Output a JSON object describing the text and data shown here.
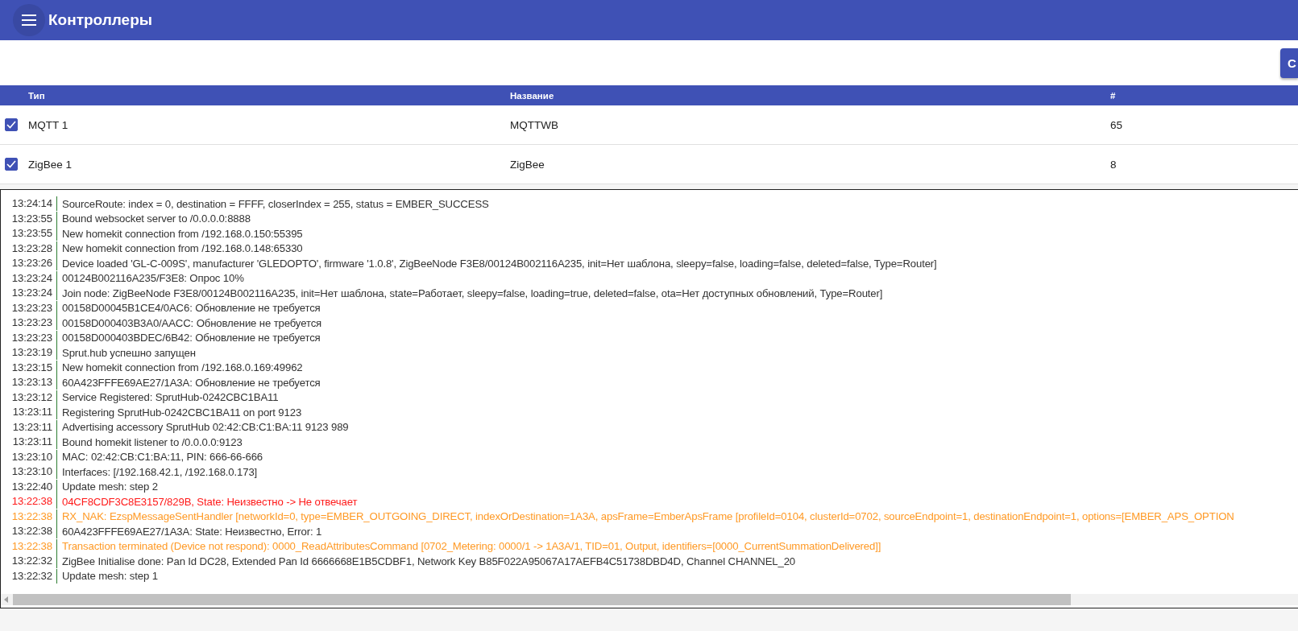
{
  "app_bar": {
    "title": "Контроллеры"
  },
  "toolbar": {
    "button": "С"
  },
  "table": {
    "columns": [
      "Тип",
      "Название",
      "#"
    ],
    "rows": [
      {
        "checked": true,
        "type": "MQTT 1",
        "name": "MQTTWB",
        "count": "65"
      },
      {
        "checked": true,
        "type": "ZigBee 1",
        "name": "ZigBee",
        "count": "8"
      }
    ]
  },
  "log": [
    {
      "time": "13:24:14",
      "kind": "info",
      "message": "SourceRoute: index = 0, destination = FFFF, closerIndex = 255, status = EMBER_SUCCESS"
    },
    {
      "time": "13:23:55",
      "kind": "info",
      "message": "Bound websocket server to /0.0.0.0:8888"
    },
    {
      "time": "13:23:55",
      "kind": "info",
      "message": "New homekit connection from /192.168.0.150:55395"
    },
    {
      "time": "13:23:28",
      "kind": "info",
      "message": "New homekit connection from /192.168.0.148:65330"
    },
    {
      "time": "13:23:26",
      "kind": "info",
      "message": "Device loaded 'GL-C-009S', manufacturer 'GLEDOPTO', firmware '1.0.8', ZigBeeNode F3E8/00124B002116A235, init=Нет шаблона, sleepy=false, loading=false, deleted=false, Type=Router]"
    },
    {
      "time": "13:23:24",
      "kind": "info",
      "message": "00124B002116A235/F3E8: Опрос 10%"
    },
    {
      "time": "13:23:24",
      "kind": "info",
      "message": "Join node: ZigBeeNode F3E8/00124B002116A235, init=Нет шаблона, state=Работает, sleepy=false, loading=true, deleted=false, ota=Нет доступных обновлений, Type=Router]"
    },
    {
      "time": "13:23:23",
      "kind": "info",
      "message": "00158D00045B1CE4/0AC6: Обновление не требуется"
    },
    {
      "time": "13:23:23",
      "kind": "info",
      "message": "00158D000403B3A0/AACC: Обновление не требуется"
    },
    {
      "time": "13:23:23",
      "kind": "info",
      "message": "00158D000403BDEC/6B42: Обновление не требуется"
    },
    {
      "time": "13:23:19",
      "kind": "info",
      "message": "Sprut.hub успешно запущен"
    },
    {
      "time": "13:23:15",
      "kind": "info",
      "message": "New homekit connection from /192.168.0.169:49962"
    },
    {
      "time": "13:23:13",
      "kind": "info",
      "message": "60A423FFFE69AE27/1A3A: Обновление не требуется"
    },
    {
      "time": "13:23:12",
      "kind": "info",
      "message": "Service Registered: SprutHub-0242CBC1BA11"
    },
    {
      "time": "13:23:11",
      "kind": "info",
      "message": "Registering SprutHub-0242CBC1BA11 on port 9123"
    },
    {
      "time": "13:23:11",
      "kind": "info",
      "message": "Advertising accessory SprutHub 02:42:CB:C1:BA:11 9123 989"
    },
    {
      "time": "13:23:11",
      "kind": "info",
      "message": "Bound homekit listener to /0.0.0.0:9123"
    },
    {
      "time": "13:23:10",
      "kind": "info",
      "message": "MAC: 02:42:CB:C1:BA:11, PIN: 666-66-666"
    },
    {
      "time": "13:23:10",
      "kind": "info",
      "message": "Interfaces: [/192.168.42.1, /192.168.0.173]"
    },
    {
      "time": "13:22:40",
      "kind": "info",
      "message": "Update mesh: step 2"
    },
    {
      "time": "13:22:38",
      "kind": "error",
      "message": "04CF8CDF3C8E3157/829B, State: Неизвестно -> Не отвечает"
    },
    {
      "time": "13:22:38",
      "kind": "warning",
      "message": "RX_NAK: EzspMessageSentHandler [networkId=0, type=EMBER_OUTGOING_DIRECT, indexOrDestination=1A3A, apsFrame=EmberApsFrame [profileId=0104, clusterId=0702, sourceEndpoint=1, destinationEndpoint=1, options=[EMBER_APS_OPTION"
    },
    {
      "time": "13:22:38",
      "kind": "info",
      "message": "60A423FFFE69AE27/1A3A: State: Неизвестно, Error: 1"
    },
    {
      "time": "13:22:38",
      "kind": "warning",
      "message": "Transaction terminated (Device not respond): 0000_ReadAttributesCommand [0702_Metering: 0000/1 -> 1A3A/1, TID=01, Output, identifiers=[0000_CurrentSummationDelivered]]"
    },
    {
      "time": "13:22:32",
      "kind": "info",
      "message": "ZigBee Initialise done: Pan Id DC28, Extended Pan Id 6666668E1B5CDBF1, Network Key B85F022A95067A17AEFB4C51738DBD4D, Channel CHANNEL_20"
    },
    {
      "time": "13:22:32",
      "kind": "info",
      "message": "Update mesh: step 1"
    }
  ]
}
